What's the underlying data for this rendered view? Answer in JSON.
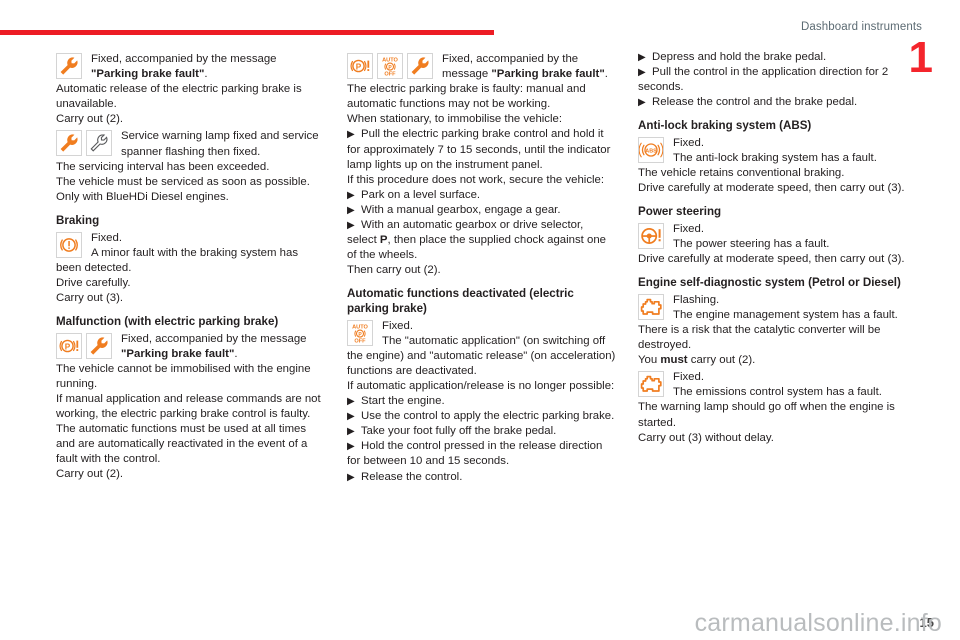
{
  "header": {
    "title": "Dashboard instruments",
    "chapter_number": "1",
    "rule_color": "#ed1c24"
  },
  "footer": {
    "page_number": "15",
    "watermark": "carmanualsonline.info"
  },
  "colors": {
    "warning_orange": "#f07d20",
    "accent_red": "#ed1c24",
    "icon_border": "#d4d4d4",
    "header_text": "#5c6b73",
    "body_text": "#231f20"
  },
  "columns": [
    {
      "blocks": [
        {
          "kind": "icon-block",
          "icons": [
            "spanner-orange-icon"
          ],
          "lead": "Fixed, accompanied by the message ",
          "lead_bold": "\"Parking brake fault\"",
          "lead_tail": ".",
          "body": "Automatic release of the electric parking brake is unavailable.\nCarry out (2)."
        },
        {
          "kind": "icon-block",
          "icons": [
            "spanner-orange-icon",
            "spanner-outline-icon"
          ],
          "lead": "Service warning lamp fixed and service spanner flashing then fixed.",
          "body": "The servicing interval has been exceeded.\nThe vehicle must be serviced as soon as possible.\nOnly with BlueHDi Diesel engines."
        },
        {
          "kind": "heading",
          "text": "Braking"
        },
        {
          "kind": "icon-block",
          "icons": [
            "brake-warning-icon"
          ],
          "lead": "Fixed.\nA minor fault with the braking system has been detected.",
          "body": "Drive carefully.\nCarry out (3)."
        },
        {
          "kind": "heading",
          "text": "Malfunction (with electric parking brake)"
        },
        {
          "kind": "icon-block",
          "icons": [
            "parking-brake-fault-icon",
            "spanner-orange-icon"
          ],
          "lead": "Fixed, accompanied by the message ",
          "lead_bold": "\"Parking brake fault\"",
          "lead_tail": ".",
          "body": "The vehicle cannot be immobilised with the engine running.\nIf manual application and release commands are not working, the electric parking brake control is faulty.\nThe automatic functions must be used at all times and are automatically reactivated in the event of a fault with the control.\nCarry out (2)."
        }
      ]
    },
    {
      "blocks": [
        {
          "kind": "icon-block",
          "icons": [
            "parking-brake-fault-icon",
            "auto-parking-brake-off-icon",
            "spanner-orange-icon"
          ],
          "lead": "Fixed, accompanied by the message ",
          "lead_bold": "\"Parking brake fault\"",
          "lead_tail": ".",
          "body": "The electric parking brake is faulty: manual and automatic functions may not be working.\nWhen stationary, to immobilise the vehicle:"
        },
        {
          "kind": "bullet",
          "text": "Pull the electric parking brake control and hold it for approximately 7 to 15 seconds, until the indicator lamp lights up on the instrument panel."
        },
        {
          "kind": "para",
          "text": "If this procedure does not work, secure the vehicle:"
        },
        {
          "kind": "bullet",
          "text": "Park on a level surface."
        },
        {
          "kind": "bullet",
          "text": "With a manual gearbox, engage a gear."
        },
        {
          "kind": "bullet",
          "text": "With an automatic gearbox or drive selector, select P, then place the supplied chock against one of the wheels.",
          "bold_token": "P"
        },
        {
          "kind": "para",
          "text": "Then carry out (2)."
        },
        {
          "kind": "heading",
          "text": "Automatic functions deactivated (electric parking brake)"
        },
        {
          "kind": "icon-block",
          "icons": [
            "auto-parking-brake-off-icon"
          ],
          "lead": "Fixed.\nThe \"automatic application\" (on switching off the engine) and \"automatic release\" (on acceleration) functions are deactivated.",
          "body": "If automatic application/release is no longer possible:"
        },
        {
          "kind": "bullet",
          "text": "Start the engine."
        },
        {
          "kind": "bullet",
          "text": "Use the control to apply the electric parking brake."
        },
        {
          "kind": "bullet",
          "text": "Take your foot fully off the brake pedal."
        },
        {
          "kind": "bullet",
          "text": "Hold the control pressed in the release direction for between 10 and 15 seconds."
        },
        {
          "kind": "bullet",
          "text": "Release the control."
        }
      ]
    },
    {
      "blocks": [
        {
          "kind": "bullet",
          "text": "Depress and hold the brake pedal."
        },
        {
          "kind": "bullet",
          "text": "Pull the control in the application direction for 2 seconds."
        },
        {
          "kind": "bullet",
          "text": "Release the control and the brake pedal."
        },
        {
          "kind": "heading",
          "text": "Anti-lock braking system (ABS)"
        },
        {
          "kind": "icon-block",
          "icons": [
            "abs-warning-icon"
          ],
          "lead": "Fixed.\nThe anti-lock braking system has a fault.",
          "body": "The vehicle retains conventional braking.\nDrive carefully at moderate speed, then carry out (3)."
        },
        {
          "kind": "heading",
          "text": "Power steering"
        },
        {
          "kind": "icon-block",
          "icons": [
            "power-steering-icon"
          ],
          "lead": "Fixed.\nThe power steering has a fault.",
          "body": "Drive carefully at moderate speed, then carry out (3)."
        },
        {
          "kind": "heading",
          "text": "Engine self-diagnostic system (Petrol or Diesel)"
        },
        {
          "kind": "icon-block",
          "icons": [
            "engine-check-icon"
          ],
          "lead": "Flashing.\nThe engine management system has a fault.",
          "body": "There is a risk that the catalytic converter will be destroyed.\nYou must carry out (2).",
          "body_bold_token": "must"
        },
        {
          "kind": "icon-block",
          "icons": [
            "engine-check-icon"
          ],
          "lead": "Fixed.\nThe emissions control system has a fault.",
          "body": "The warning lamp should go off when the engine is started.\nCarry out (3) without delay."
        }
      ]
    }
  ]
}
